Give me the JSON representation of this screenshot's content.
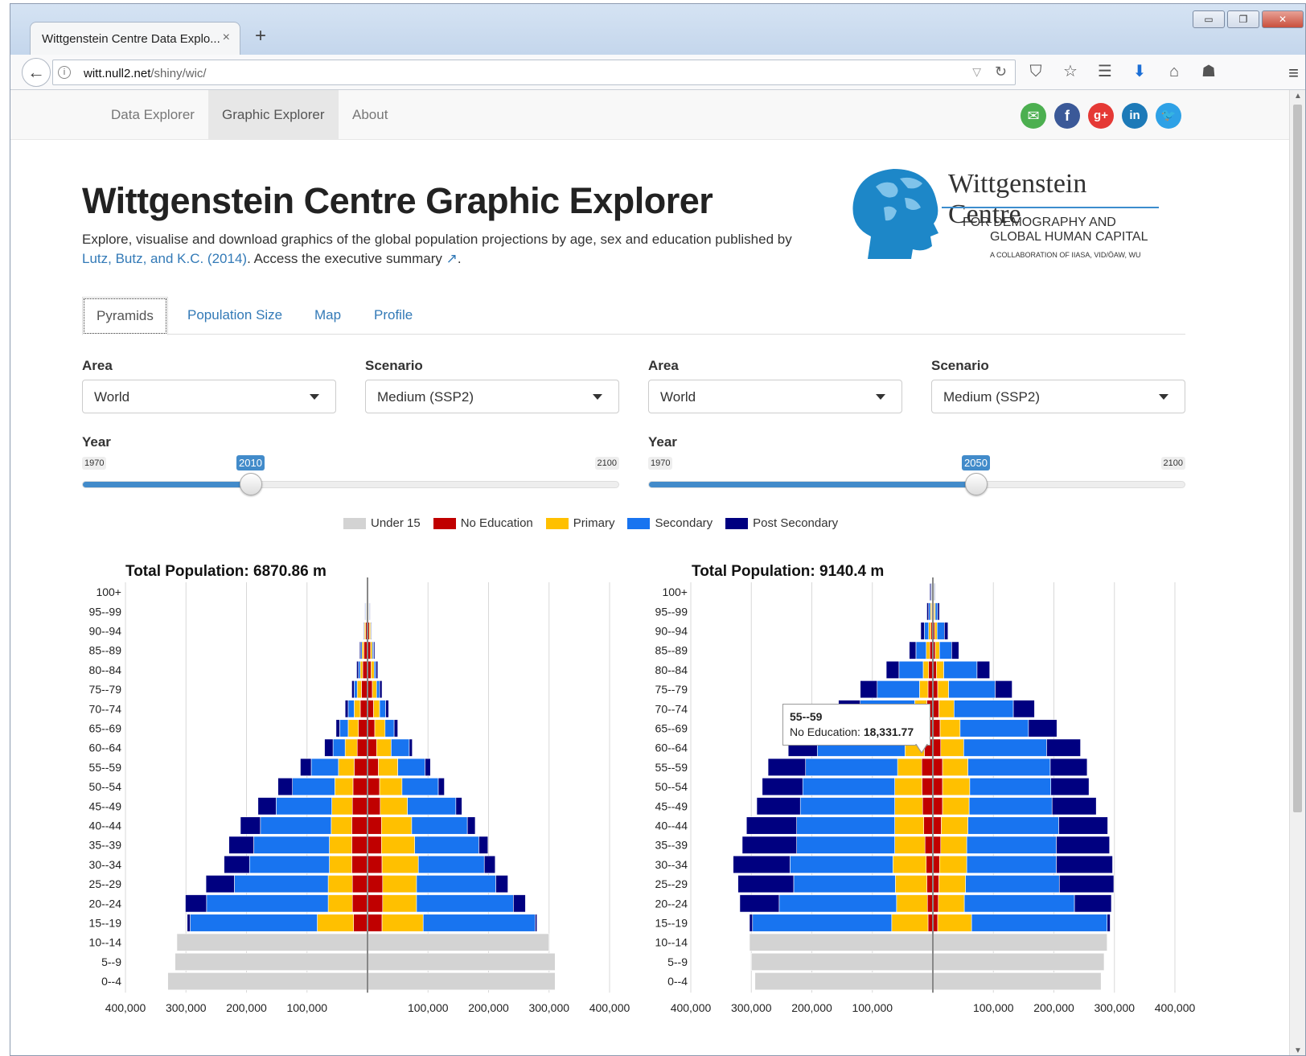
{
  "browser": {
    "tab_title": "Wittgenstein Centre Data Explo...",
    "tab_close": "×",
    "new_tab": "+",
    "url_host": "witt.null2.net",
    "url_path": "/shiny/wic/",
    "window_minimize": "▭",
    "window_restore": "❐",
    "window_close": "✕"
  },
  "site_nav": {
    "items": [
      {
        "label": "Data Explorer",
        "active": false
      },
      {
        "label": "Graphic Explorer",
        "active": true
      },
      {
        "label": "About",
        "active": false
      }
    ],
    "social": [
      {
        "name": "email",
        "glyph": "✉",
        "color": "#4caf50"
      },
      {
        "name": "facebook",
        "glyph": "f",
        "color": "#3b5998"
      },
      {
        "name": "googleplus",
        "glyph": "g+",
        "color": "#e53935"
      },
      {
        "name": "linkedin",
        "glyph": "in",
        "color": "#1d7ab8"
      },
      {
        "name": "twitter",
        "glyph": "🐦",
        "color": "#2ea1e6"
      }
    ]
  },
  "header": {
    "title": "Wittgenstein Centre Graphic Explorer",
    "intro_text": "Explore, visualise and download graphics of the global population projections by age, sex and education published by",
    "intro_link": "Lutz, Butz, and K.C. (2014)",
    "intro_after": ". Access the executive summary",
    "intro_end": "."
  },
  "logo": {
    "title": "Wittgenstein Centre",
    "sub1": "FOR DEMOGRAPHY AND",
    "sub2": "GLOBAL HUMAN CAPITAL",
    "sub3": "A COLLABORATION OF IIASA, VID/ÖAW, WU"
  },
  "tabs": [
    {
      "label": "Pyramids",
      "active": true
    },
    {
      "label": "Population Size",
      "active": false
    },
    {
      "label": "Map",
      "active": false
    },
    {
      "label": "Profile",
      "active": false
    }
  ],
  "controls": {
    "area_label": "Area",
    "scenario_label": "Scenario",
    "year_label": "Year",
    "left": {
      "area": "World",
      "scenario": "Medium (SSP2)",
      "year_min": "1970",
      "year_max": "2100",
      "year": "2010"
    },
    "right": {
      "area": "World",
      "scenario": "Medium (SSP2)",
      "year_min": "1970",
      "year_max": "2100",
      "year": "2050"
    }
  },
  "legend": [
    {
      "label": "Under 15",
      "color": "#d3d3d3"
    },
    {
      "label": "No Education",
      "color": "#c00000"
    },
    {
      "label": "Primary",
      "color": "#ffc000"
    },
    {
      "label": "Secondary",
      "color": "#1874f0"
    },
    {
      "label": "Post Secondary",
      "color": "#000080"
    }
  ],
  "tooltip": {
    "title": "55--59",
    "label": "No Education:",
    "value": "18,331.77"
  },
  "chart_data": [
    {
      "type": "bar",
      "title": "Total Population: 6870.86 m",
      "age_groups": [
        "100+",
        "95--99",
        "90--94",
        "85--89",
        "80--84",
        "75--79",
        "70--74",
        "65--69",
        "60--64",
        "55--59",
        "50--54",
        "45--49",
        "40--44",
        "35--39",
        "30--34",
        "25--29",
        "20--24",
        "15--19",
        "10--14",
        "5--9",
        "0--4"
      ],
      "x_ticks": [
        "400,000",
        "300,000",
        "200,000",
        "100,000",
        "",
        "100,000",
        "200,000",
        "300,000",
        "400,000"
      ],
      "xlim": [
        -400000,
        400000
      ],
      "left_side": {
        "under15": [
          0,
          0,
          0,
          0,
          0,
          0,
          0,
          0,
          0,
          0,
          0,
          0,
          0,
          0,
          0,
          0,
          0,
          0,
          315000,
          318000,
          330000
        ],
        "no_education": [
          500,
          1500,
          3000,
          6000,
          8000,
          10000,
          12000,
          15000,
          17000,
          22000,
          24000,
          25000,
          26000,
          26000,
          26000,
          25000,
          25000,
          23000,
          0,
          0,
          0
        ],
        "primary": [
          500,
          1000,
          2000,
          3000,
          4000,
          7000,
          10000,
          17000,
          20000,
          26000,
          30000,
          34000,
          34000,
          37000,
          37000,
          40000,
          40000,
          60000,
          0,
          0,
          0
        ],
        "secondary": [
          500,
          1000,
          1000,
          2000,
          3000,
          5000,
          10000,
          14000,
          20000,
          45000,
          70000,
          92000,
          117000,
          125000,
          132000,
          155000,
          201000,
          210000,
          0,
          0,
          0
        ],
        "post_secondary": [
          500,
          1000,
          1000,
          2000,
          3000,
          4000,
          5000,
          6000,
          14000,
          18000,
          24000,
          30000,
          33000,
          41000,
          42000,
          47000,
          35000,
          5000,
          0,
          0,
          0
        ]
      },
      "right_side": {
        "under15": [
          0,
          0,
          0,
          0,
          0,
          0,
          0,
          0,
          0,
          0,
          0,
          0,
          0,
          0,
          0,
          0,
          0,
          0,
          300000,
          310000,
          310000
        ],
        "no_education": [
          500,
          1500,
          3000,
          5000,
          6000,
          8000,
          10000,
          12000,
          15000,
          18000,
          20000,
          21000,
          23000,
          23000,
          24000,
          25000,
          25000,
          24000,
          0,
          0,
          0
        ],
        "primary": [
          500,
          1000,
          2000,
          3000,
          5000,
          7000,
          10000,
          17000,
          24000,
          32000,
          37000,
          45000,
          50000,
          55000,
          60000,
          56000,
          56000,
          68000,
          0,
          0,
          0
        ],
        "secondary": [
          500,
          1000,
          1000,
          2000,
          3000,
          5000,
          10000,
          15000,
          30000,
          45000,
          60000,
          80000,
          92000,
          106000,
          109000,
          131000,
          160000,
          185000,
          0,
          0,
          0
        ],
        "post_secondary": [
          500,
          1000,
          1000,
          2000,
          3000,
          4000,
          5000,
          6000,
          5000,
          9000,
          10000,
          10000,
          13000,
          15000,
          18000,
          20000,
          20000,
          3000,
          0,
          0,
          0
        ]
      }
    },
    {
      "type": "bar",
      "title": "Total Population: 9140.4 m",
      "age_groups": [
        "100+",
        "95--99",
        "90--94",
        "85--89",
        "80--84",
        "75--79",
        "70--74",
        "65--69",
        "60--64",
        "55--59",
        "50--54",
        "45--49",
        "40--44",
        "35--39",
        "30--34",
        "25--29",
        "20--24",
        "15--19",
        "10--14",
        "5--9",
        "0--4"
      ],
      "x_ticks": [
        "400,000",
        "300,000",
        "200,000",
        "100,000",
        "",
        "100,000",
        "200,000",
        "300,000",
        "400,000"
      ],
      "xlim": [
        -400000,
        400000
      ],
      "left_side": {
        "under15": [
          0,
          0,
          0,
          0,
          0,
          0,
          0,
          0,
          0,
          0,
          0,
          0,
          0,
          0,
          0,
          0,
          0,
          0,
          303000,
          300000,
          294000
        ],
        "no_education": [
          1000,
          2000,
          3000,
          5000,
          7000,
          8000,
          10000,
          12000,
          14000,
          18331.77,
          18000,
          17000,
          15000,
          13000,
          11000,
          10000,
          9000,
          8000,
          0,
          0,
          0
        ],
        "primary": [
          1000,
          2000,
          4000,
          6000,
          9000,
          14000,
          20000,
          26000,
          32000,
          40000,
          45000,
          46000,
          48000,
          50000,
          55000,
          52000,
          51000,
          60000,
          0,
          0,
          0
        ],
        "secondary": [
          1000,
          3000,
          7000,
          17000,
          40000,
          70000,
          90000,
          113000,
          145000,
          152000,
          152000,
          156000,
          162000,
          162000,
          170000,
          168000,
          194000,
          230000,
          0,
          0,
          0
        ],
        "post_secondary": [
          2000,
          3000,
          6000,
          11000,
          21000,
          28000,
          36000,
          45000,
          48000,
          62000,
          67000,
          72000,
          83000,
          90000,
          94000,
          92000,
          65000,
          5000,
          0,
          0,
          0
        ]
      },
      "right_side": {
        "under15": [
          0,
          0,
          0,
          0,
          0,
          0,
          0,
          0,
          0,
          0,
          0,
          0,
          0,
          0,
          0,
          0,
          0,
          0,
          288000,
          283000,
          278000
        ],
        "no_education": [
          1000,
          2000,
          3000,
          4000,
          6000,
          8000,
          10000,
          12000,
          13000,
          16000,
          16000,
          16000,
          14000,
          13000,
          11000,
          10000,
          9000,
          8000,
          0,
          0,
          0
        ],
        "primary": [
          1000,
          2000,
          4000,
          7000,
          12000,
          18000,
          25000,
          33000,
          38000,
          42000,
          45000,
          44000,
          44000,
          43000,
          45000,
          44000,
          43000,
          56000,
          0,
          0,
          0
        ],
        "secondary": [
          1000,
          4000,
          12000,
          20000,
          55000,
          77000,
          98000,
          113000,
          137000,
          136000,
          134000,
          137000,
          150000,
          148000,
          148000,
          155000,
          182000,
          224000,
          0,
          0,
          0
        ],
        "post_secondary": [
          1000,
          3000,
          6000,
          12000,
          21000,
          28000,
          35000,
          47000,
          56000,
          61000,
          63000,
          73000,
          81000,
          88000,
          93000,
          90000,
          61000,
          5000,
          0,
          0,
          0
        ]
      }
    }
  ]
}
